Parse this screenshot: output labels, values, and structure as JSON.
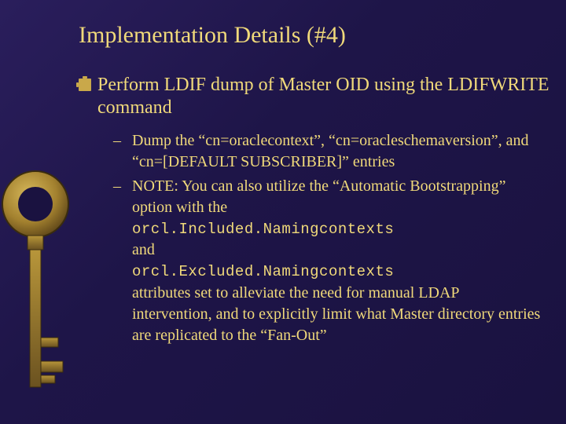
{
  "title": "Implementation Details (#4)",
  "bullet": {
    "text": "Perform LDIF dump of Master OID using the LDIFWRITE command"
  },
  "sub": {
    "item1": "Dump the “cn=oraclecontext”, “cn=oracleschemaversion”, and “cn=[DEFAULT SUBSCRIBER]” entries",
    "item2_lead": "NOTE: You can also utilize the “Automatic Bootstrapping” option with the",
    "item2_code1": "orcl.Included.Namingcontexts",
    "item2_and": "and",
    "item2_code2": "orcl.Excluded.Namingcontexts",
    "item2_tail": "attributes set to alleviate the need for manual LDAP intervention, and to explicitly limit what Master directory entries are replicated to the “Fan-Out”"
  },
  "icons": {
    "bullet": "puzzle-piece",
    "key": "vintage-key"
  }
}
